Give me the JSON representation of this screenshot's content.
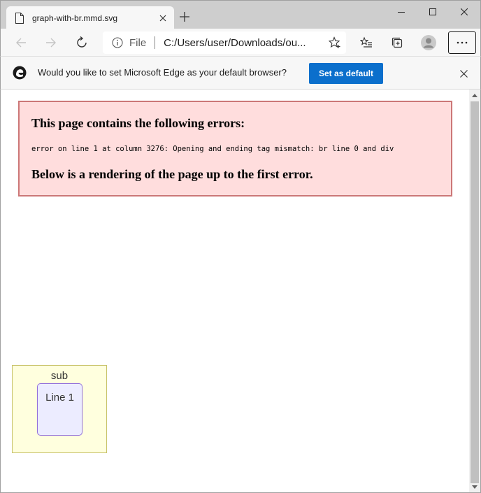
{
  "tab": {
    "title": "graph-with-br.mmd.svg",
    "favicon": "document-icon",
    "close": "close-icon"
  },
  "new_tab": "plus-icon",
  "window_controls": [
    "minimize-icon",
    "maximize-icon",
    "close-icon"
  ],
  "toolbar": {
    "back": "back-arrow-icon",
    "forward": "forward-arrow-icon",
    "refresh": "refresh-icon",
    "address": {
      "scheme_label": "File",
      "url": "C:/Users/user/Downloads/ou...",
      "info_icon": "info-icon",
      "favorite_icon": "star-add-icon"
    },
    "favorites": "favorites-list-icon",
    "collections": "collections-icon",
    "profile": "profile-avatar",
    "menu": "more-menu-icon"
  },
  "infobar": {
    "message": "Would you like to set Microsoft Edge as your default browser?",
    "button_label": "Set as default",
    "accent_color": "#0b6fcc"
  },
  "error": {
    "heading": "This page contains the following errors:",
    "message": "error on line 1 at column 3276: Opening and ending tag mismatch: br line 0 and div",
    "footer": "Below is a rendering of the page up to the first error.",
    "background_color": "#ffdddd",
    "border_color": "#cc7777"
  },
  "diagram": {
    "subgraph_label": "sub",
    "node_label": "Line 1"
  }
}
